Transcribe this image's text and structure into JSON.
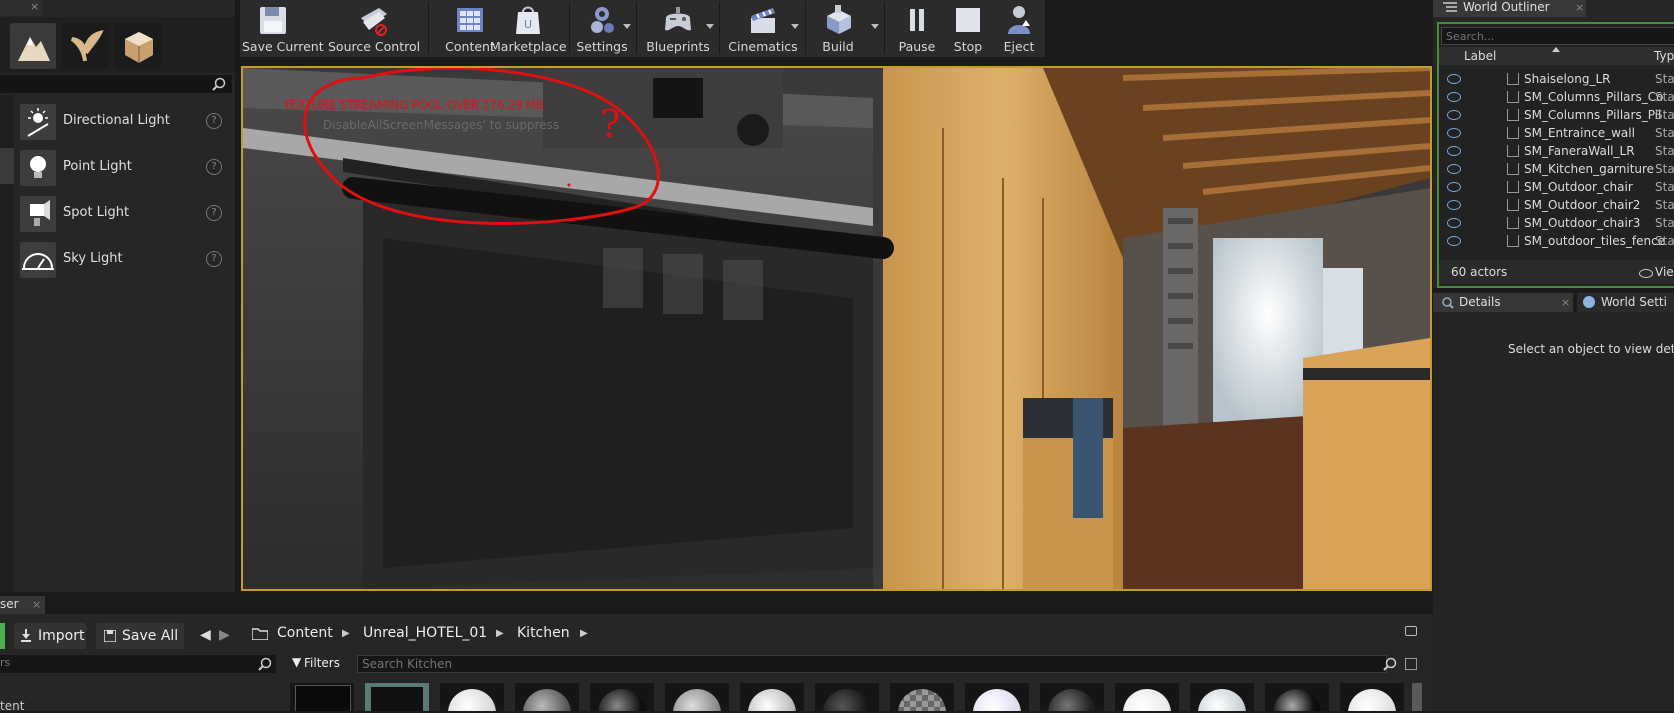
{
  "modes_panel": {
    "tab_close": "×",
    "search_placeholder": "",
    "place_items": [
      {
        "label": "Directional Light",
        "icon": "directional-light-icon"
      },
      {
        "label": "Point Light",
        "icon": "point-light-icon"
      },
      {
        "label": "Spot Light",
        "icon": "spot-light-icon"
      },
      {
        "label": "Sky Light",
        "icon": "sky-light-icon"
      }
    ],
    "help_glyph": "?"
  },
  "toolbar": {
    "buttons": [
      {
        "label": "Save Current",
        "icon": "save-icon"
      },
      {
        "label": "Source Control",
        "icon": "source-control-icon"
      },
      {
        "label": "Content",
        "icon": "content-icon"
      },
      {
        "label": "Marketplace",
        "icon": "marketplace-icon"
      },
      {
        "label": "Settings",
        "icon": "settings-icon"
      },
      {
        "label": "Blueprints",
        "icon": "blueprints-icon"
      },
      {
        "label": "Cinematics",
        "icon": "cinematics-icon"
      },
      {
        "label": "Build",
        "icon": "build-icon"
      },
      {
        "label": "Pause",
        "icon": "pause-icon"
      },
      {
        "label": "Stop",
        "icon": "stop-icon"
      },
      {
        "label": "Eject",
        "icon": "eject-icon"
      }
    ]
  },
  "viewport": {
    "warning_text": "TEXTURE STREAMING POOL OVER 176.29 MB",
    "hint_text": "DisableAllScreenMessages' to suppress",
    "annotation_glyph": "?",
    "colors": {
      "warning": "#d01818",
      "annotation": "#e01010",
      "border": "#c79b2a"
    }
  },
  "world_outliner": {
    "tab_title": "World Outliner",
    "tab_close": "×",
    "search_placeholder": "Search...",
    "col_label": "Label",
    "col_type": "Typ",
    "rows": [
      {
        "name": "Shaiselong_LR",
        "type": "Stat"
      },
      {
        "name": "SM_Columns_Pillars_Co",
        "type": "Stat"
      },
      {
        "name": "SM_Columns_Pillars_Pil",
        "type": "Stat"
      },
      {
        "name": "SM_Entraince_wall",
        "type": "Stat"
      },
      {
        "name": "SM_FaneraWall_LR",
        "type": "Stat"
      },
      {
        "name": "SM_Kitchen_garniture",
        "type": "Stat"
      },
      {
        "name": "SM_Outdoor_chair",
        "type": "Stat"
      },
      {
        "name": "SM_Outdoor_chair2",
        "type": "Stat"
      },
      {
        "name": "SM_Outdoor_chair3",
        "type": "Stat"
      },
      {
        "name": "SM_outdoor_tiles_fence",
        "type": "Stat"
      }
    ],
    "actor_count": "60 actors",
    "view_options": "Vie"
  },
  "details": {
    "tab_title": "Details",
    "tab_close": "×",
    "world_settings_tab": "World Setti",
    "empty_message": "Select an object to view details."
  },
  "content_browser": {
    "tab_title": "ser",
    "tab_close": "×",
    "import_label": "Import",
    "save_all_label": "Save All",
    "breadcrumbs": [
      "Content",
      "Unreal_HOTEL_01",
      "Kitchen"
    ],
    "filters_label": "Filters",
    "search_placeholder": "Search Kitchen",
    "left_search_placeholder": "rs",
    "tree_item": "tent"
  }
}
